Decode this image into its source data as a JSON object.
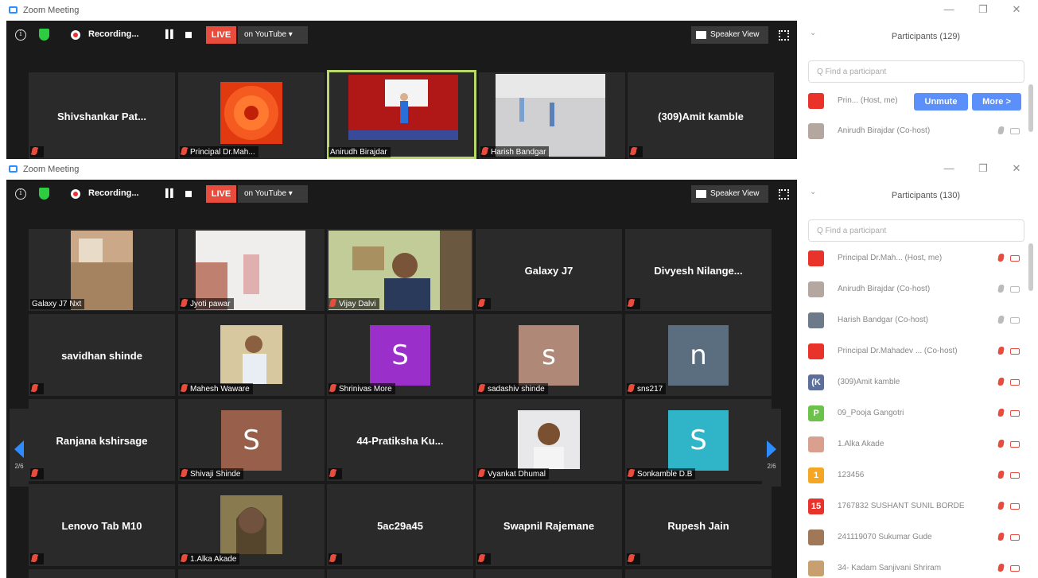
{
  "window1": {
    "title": "Zoom Meeting",
    "toolbar": {
      "recording": "Recording...",
      "live": "LIVE",
      "youtube": "on YouTube ▾",
      "speaker_view": "Speaker View"
    },
    "tiles": [
      {
        "name": "Shivshankar  Pat..."
      },
      {
        "tag": "Principal Dr.Mah..."
      },
      {
        "tag": "Anirudh Birajdar"
      },
      {
        "tag": "Harish Bandgar"
      },
      {
        "name": "(309)Amit kamble"
      }
    ],
    "panel": {
      "title": "Participants (129)",
      "search_placeholder": "Q Find a participant",
      "row1_name": "Prin... (Host, me)",
      "unmute": "Unmute",
      "more": "More >",
      "row2_name": "Anirudh Birajdar (Co-host)"
    }
  },
  "window2": {
    "title": "Zoom Meeting",
    "toolbar": {
      "recording": "Recording...",
      "live": "LIVE",
      "youtube": "on YouTube ▾",
      "speaker_view": "Speaker View"
    },
    "tiles": [
      {
        "tag": "Galaxy J7 Nxt"
      },
      {
        "tag": "Jyoti pawar"
      },
      {
        "tag": "Vijay Dalvi"
      },
      {
        "name": "Galaxy J7"
      },
      {
        "name": "Divyesh  Nilange..."
      },
      {
        "name": "savidhan shinde"
      },
      {
        "tag": "Mahesh Waware"
      },
      {
        "tag": "Shrinivas More",
        "letter": "S"
      },
      {
        "tag": "sadashiv shinde",
        "letter": "s"
      },
      {
        "tag": "sns217",
        "letter": "n"
      },
      {
        "name": "Ranjana kshirsage"
      },
      {
        "tag": "Shivaji Shinde",
        "letter": "S"
      },
      {
        "name": "44-Pratiksha  Ku..."
      },
      {
        "tag": "Vyankat Dhumal"
      },
      {
        "tag": "Sonkamble D.B",
        "letter": "S"
      },
      {
        "name": "Lenovo Tab M10"
      },
      {
        "tag": "1.Alka Akade"
      },
      {
        "name": "5ac29a45"
      },
      {
        "name": "Swapnil Rajemane"
      },
      {
        "name": "Rupesh Jain"
      }
    ],
    "page_left": "2/6",
    "page_right": "2/6",
    "panel": {
      "title": "Participants (130)",
      "search_placeholder": "Q Find a participant",
      "rows": [
        {
          "name": "Principal Dr.Mah... (Host, me)",
          "avatar": "",
          "color": "#e8322a"
        },
        {
          "name": "Anirudh Birajdar (Co-host)",
          "avatar": "",
          "color": "#b4a7a0"
        },
        {
          "name": "Harish Bandgar (Co-host)",
          "avatar": "",
          "color": "#6c7a89"
        },
        {
          "name": "Principal Dr.Mahadev ... (Co-host)",
          "avatar": "",
          "color": "#e8322a"
        },
        {
          "name": "(309)Amit kamble",
          "avatar": "(K",
          "color": "#5b6f9a"
        },
        {
          "name": "09_Pooja Gangotri",
          "avatar": "P",
          "color": "#6dc24b"
        },
        {
          "name": "1.Alka Akade",
          "avatar": "",
          "color": "#d9a090"
        },
        {
          "name": "123456",
          "avatar": "1",
          "color": "#f5a623"
        },
        {
          "name": "1767832 SUSHANT SUNIL BORDE",
          "avatar": "15",
          "color": "#e8322a"
        },
        {
          "name": "241119070 Sukumar Gude",
          "avatar": "",
          "color": "#a07858"
        },
        {
          "name": "34- Kadam Sanjivani Shriram",
          "avatar": "",
          "color": "#c8a070"
        }
      ]
    }
  },
  "colors": {
    "live": "#e74c3c",
    "accent": "#5b8ff9",
    "active_border": "#b9d86a",
    "mic_off": "#e74c3c"
  }
}
